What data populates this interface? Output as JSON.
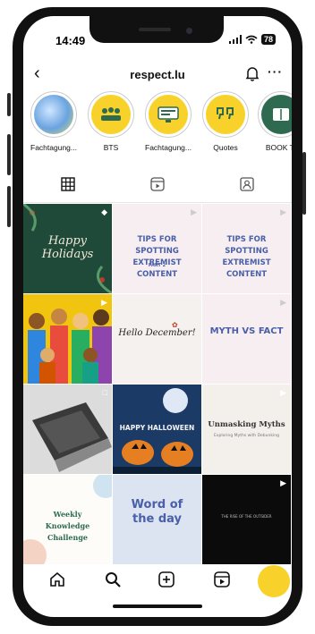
{
  "status": {
    "time": "14:49",
    "battery": "78"
  },
  "header": {
    "handle": "respect.lu"
  },
  "stories": [
    {
      "label": "Fachtagung...",
      "icon": "globe-icon"
    },
    {
      "label": "BTS",
      "icon": "people-icon"
    },
    {
      "label": "Fachtagung...",
      "icon": "screen-icon"
    },
    {
      "label": "Quotes",
      "icon": "quote-icon"
    },
    {
      "label": "BOOK TI",
      "icon": "book-icon"
    }
  ],
  "tabs": [
    {
      "name": "grid-icon"
    },
    {
      "name": "reels-icon"
    },
    {
      "name": "tagged-icon"
    }
  ],
  "posts": {
    "p1": "Happy Holidays",
    "p2": "TIPS FOR SPOTTING EXTREMIST CONTENT",
    "p2_sub": "PART 2",
    "p3": "TIPS FOR SPOTTING EXTREMIST CONTENT",
    "p5": "Hello December!",
    "p6": "MYTH VS FACT",
    "p8": "HAPPY HALLOWEEN",
    "p9": "Unmasking Myths",
    "p9_sub": "Exploring Myths with Debunking",
    "p10": "Weekly Knowledge Challenge",
    "p11": "Word of the day",
    "p12": "THE RISE OF THE OUTSIDER"
  },
  "colors": {
    "accent": "#f8d22a",
    "dark_green": "#1f4a3a",
    "pale_pink": "#f6eef0",
    "navy_text": "#4a5fa8"
  }
}
